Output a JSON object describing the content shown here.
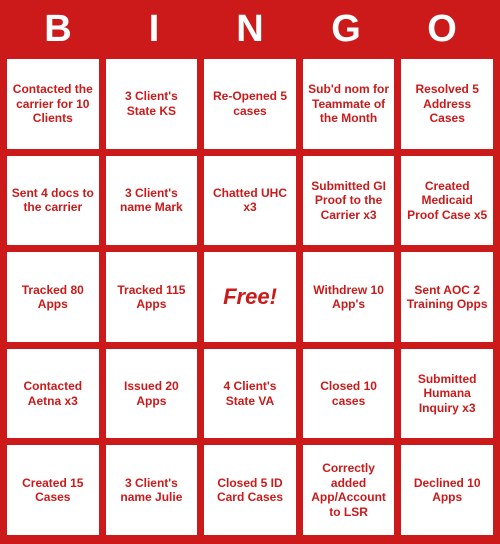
{
  "header": {
    "letters": [
      "B",
      "I",
      "N",
      "G",
      "O"
    ]
  },
  "cells": [
    "Contacted the carrier for 10 Clients",
    "3 Client's State KS",
    "Re-Opened 5 cases",
    "Sub'd nom for Teammate of the Month",
    "Resolved 5 Address Cases",
    "Sent 4 docs to the carrier",
    "3 Client's name Mark",
    "Chatted UHC x3",
    "Submitted GI Proof to the Carrier x3",
    "Created Medicaid Proof Case x5",
    "Tracked 80 Apps",
    "Tracked 115 Apps",
    "Free!",
    "Withdrew 10 App's",
    "Sent AOC 2 Training Opps",
    "Contacted Aetna x3",
    "Issued 20 Apps",
    "4 Client's State VA",
    "Closed 10 cases",
    "Submitted Humana Inquiry x3",
    "Created 15 Cases",
    "3 Client's name Julie",
    "Closed 5 ID Card Cases",
    "Correctly added App/Account to LSR",
    "Declined 10 Apps"
  ]
}
